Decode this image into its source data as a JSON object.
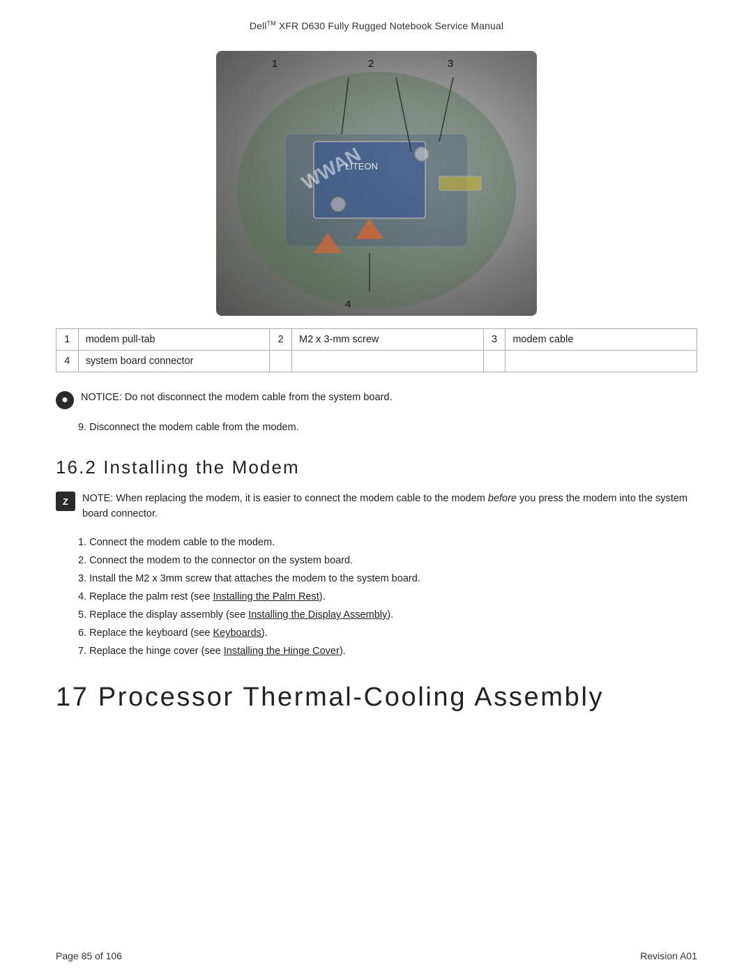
{
  "header": {
    "title": "Dell",
    "tm": "TM",
    "subtitle": " XFR D630 Fully Rugged Notebook Service Manual"
  },
  "diagram": {
    "labels": [
      "1",
      "2",
      "3",
      "4"
    ]
  },
  "table": {
    "rows": [
      {
        "num1": "1",
        "label1": "modem pull-tab",
        "num2": "2",
        "label2": "M2 x 3-mm screw",
        "num3": "3",
        "label3": "modem cable"
      },
      {
        "num1": "4",
        "label1": "system board connector",
        "num2": "",
        "label2": "",
        "num3": "",
        "label3": ""
      }
    ]
  },
  "notice": {
    "icon": "●",
    "text": "NOTICE: Do not disconnect the modem cable from the system board."
  },
  "step9": {
    "text": "9.   Disconnect the modem cable from the modem."
  },
  "section162": {
    "heading": "16.2    Installing the Modem"
  },
  "note": {
    "icon": "Z",
    "text": "NOTE: When replacing the modem, it is easier to connect the modem cable to the modem ",
    "italic": "before",
    "text2": " you press the modem into the system board connector."
  },
  "steps162": [
    "1.   Connect the modem cable to the modem.",
    "2.   Connect the modem to the connector on the system board.",
    "3.   Install the M2 x 3mm screw that attaches the modem to the system board.",
    "4.   Replace the palm rest (see ",
    "5.   Replace the display assembly (see ",
    "6.   Replace the keyboard (see ",
    "7.   Replace the hinge cover (see "
  ],
  "links": {
    "palm_rest": "Installing the Palm Rest",
    "display": "Installing the Display Assembly",
    "keyboard": "Keyboards",
    "hinge": "Installing the Hinge Cover"
  },
  "chapter17": {
    "heading": "17   Processor Thermal-Cooling Assembly"
  },
  "footer": {
    "left": "Page 85 of 106",
    "right": "Revision A01"
  }
}
